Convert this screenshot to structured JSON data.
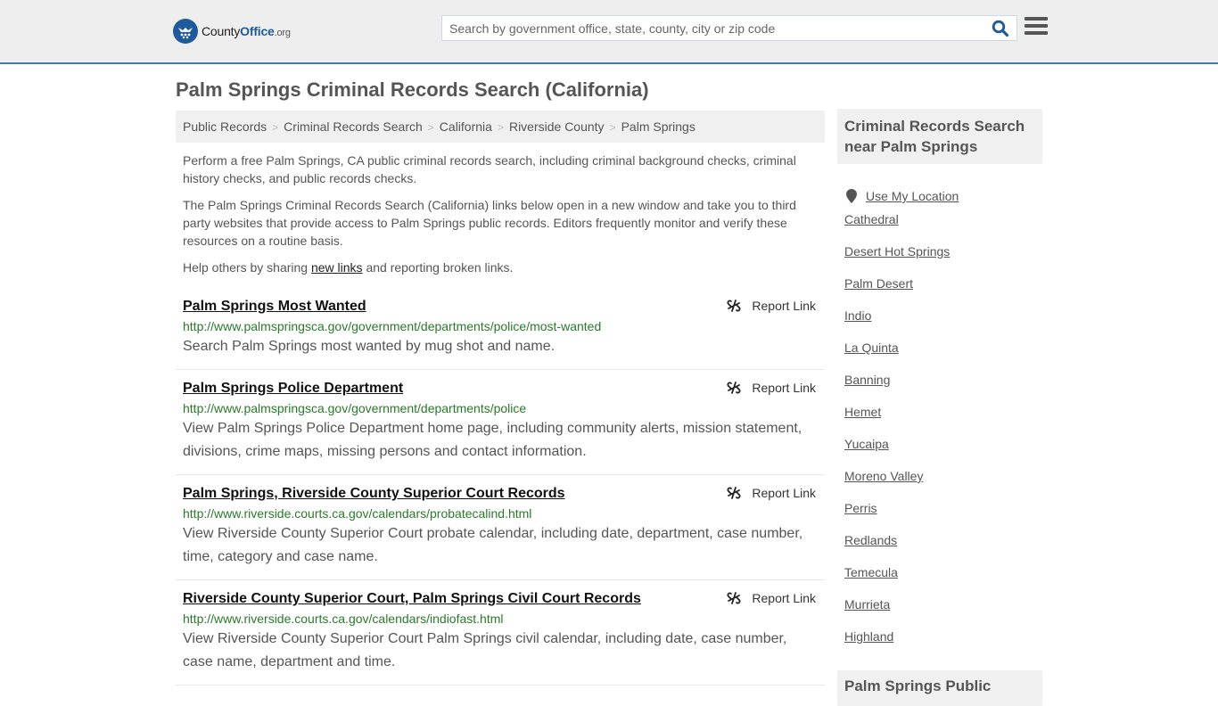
{
  "header": {
    "logo": {
      "name": "County",
      "bold": "Office",
      "tld": ".org"
    },
    "search_placeholder": "Search by government office, state, county, city or zip code",
    "search_value": "",
    "search_icon": "search-icon",
    "menu_icon": "hamburger-menu-icon",
    "accent_color": "#3a7db5"
  },
  "page_title": "Palm Springs Criminal Records Search (California)",
  "breadcrumb": [
    {
      "label": "Public Records"
    },
    {
      "label": "Criminal Records Search"
    },
    {
      "label": "California"
    },
    {
      "label": "Riverside County"
    },
    {
      "label": "Palm Springs"
    }
  ],
  "intro": {
    "p1": "Perform a free Palm Springs, CA public criminal records search, including criminal background checks, criminal history checks, and public records checks.",
    "p2": "The Palm Springs Criminal Records Search (California) links below open in a new window and take you to third party websites that provide access to Palm Springs public records. Editors frequently monitor and verify these resources on a routine basis.",
    "p3_before": "Help others by sharing ",
    "p3_link": "new links",
    "p3_after": " and reporting broken links."
  },
  "records": [
    {
      "title": "Palm Springs Most Wanted",
      "url": "http://www.palmspringsca.gov/government/departments/police/most-wanted",
      "description": "Search Palm Springs most wanted by mug shot and name.",
      "report_label": "Report Link"
    },
    {
      "title": "Palm Springs Police Department",
      "url": "http://www.palmspringsca.gov/government/departments/police",
      "description": "View Palm Springs Police Department home page, including community alerts, mission statement, divisions, crime maps, missing persons and contact information.",
      "report_label": "Report Link"
    },
    {
      "title": "Palm Springs, Riverside County Superior Court Records",
      "url": "http://www.riverside.courts.ca.gov/calendars/probatecalind.html",
      "description": "View Riverside County Superior Court probate calendar, including date, department, case number, time, category and case name.",
      "report_label": "Report Link"
    },
    {
      "title": "Riverside County Superior Court, Palm Springs Civil Court Records",
      "url": "http://www.riverside.courts.ca.gov/calendars/indiofast.html",
      "description": "View Riverside County Superior Court Palm Springs civil calendar, including date, case number, case name, department and time.",
      "report_label": "Report Link"
    }
  ],
  "sidebar": {
    "heading": "Criminal Records Search near Palm Springs",
    "use_location": "Use My Location",
    "cities": [
      "Cathedral",
      "Desert Hot Springs",
      "Palm Desert",
      "Indio",
      "La Quinta",
      "Banning",
      "Hemet",
      "Yucaipa",
      "Moreno Valley",
      "Perris",
      "Redlands",
      "Temecula",
      "Murrieta",
      "Highland"
    ],
    "next_heading": "Palm Springs Public"
  }
}
